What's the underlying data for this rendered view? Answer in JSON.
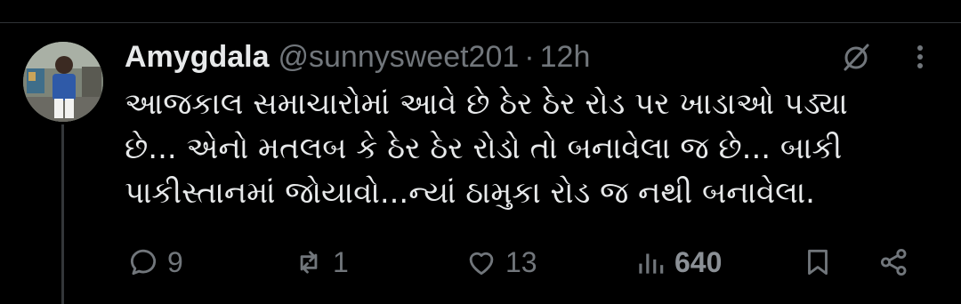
{
  "tweet": {
    "display_name": "Amygdala",
    "handle": "@sunnysweet201",
    "separator": "·",
    "time": "12h",
    "text": "આજકાલ સમાચારોમાં આવે છે ઠેર ઠેર રોડ પર ખાડાઓ પડ્યા\nછે... એનો મતલબ કે ઠેર ઠેર રોડો તો બનાવેલા જ છે... બાકી\nપાકીસ્તાનમાં જોયાવો...ન્યાં ઠામુકા રોડ જ નથી બનાવેલા."
  },
  "actions": {
    "replies": "9",
    "retweets": "1",
    "likes": "13",
    "views": "640"
  },
  "icons": {
    "reply": "reply-icon",
    "retweet": "retweet-icon",
    "like": "heart-icon",
    "views": "views-icon",
    "bookmark": "bookmark-icon",
    "share": "share-icon",
    "grok": "grok-icon",
    "more": "more-icon"
  },
  "colors": {
    "background": "#000000",
    "text": "#e7e9ea",
    "secondary": "#71767b"
  }
}
